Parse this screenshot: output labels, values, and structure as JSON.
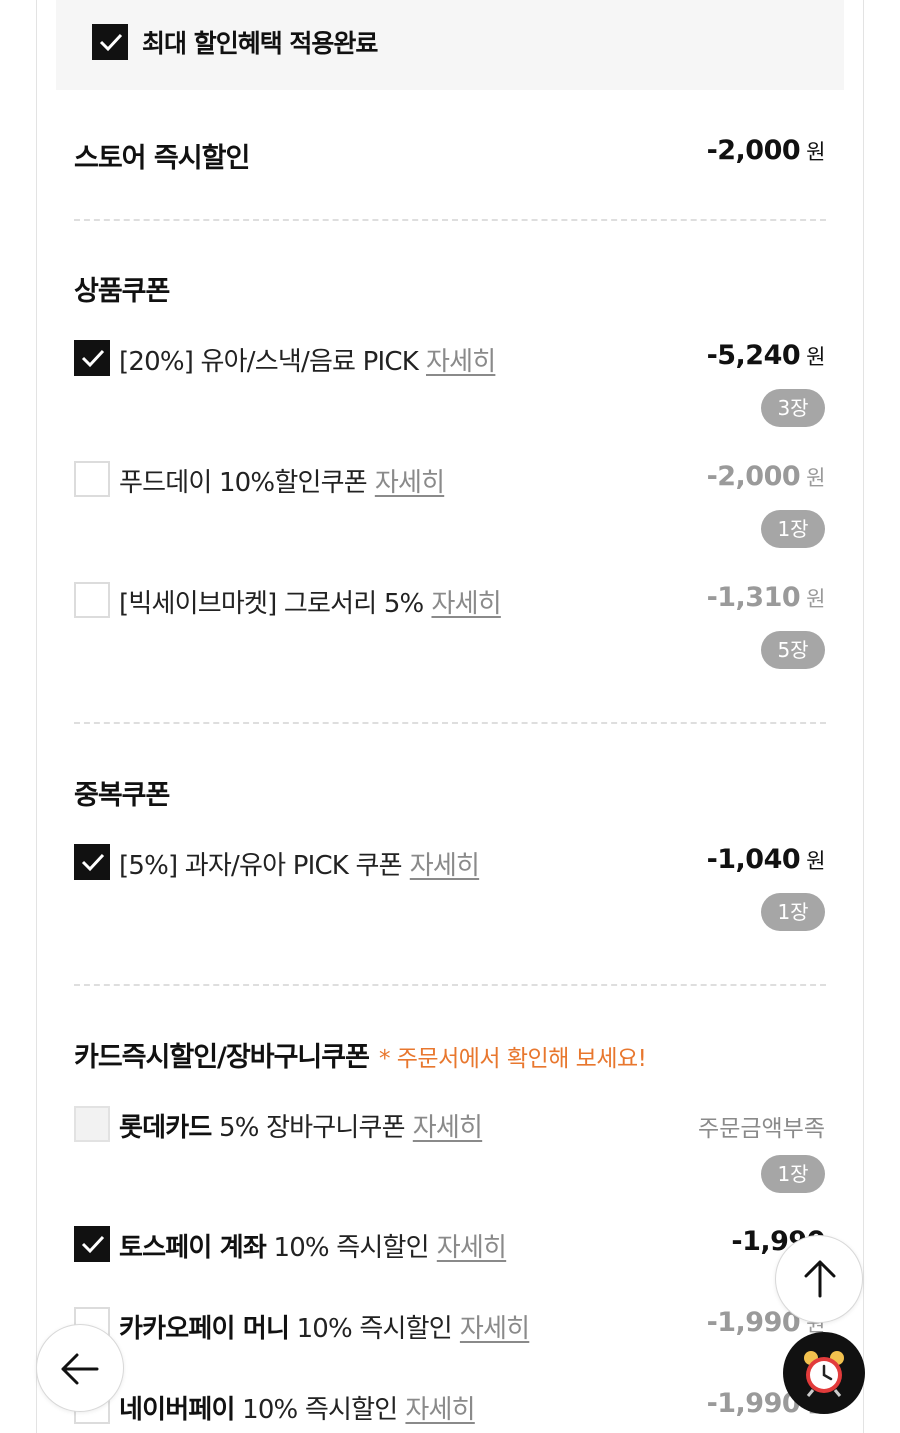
{
  "header": {
    "title": "최대 할인혜택 적용완료"
  },
  "store": {
    "title": "스토어 즉시할인",
    "amount": "-2,000",
    "unit": "원"
  },
  "product_coupons": {
    "title": "상품쿠폰",
    "items": [
      {
        "label": "[20%] 유아/스낵/음료 PICK",
        "detail": "자세히",
        "amount": "-5,240",
        "unit": "원",
        "count": "3장"
      },
      {
        "label": "푸드데이 10%할인쿠폰",
        "detail": "자세히",
        "amount": "-2,000",
        "unit": "원",
        "count": "1장"
      },
      {
        "label": "[빅세이브마켓] 그로서리 5%",
        "detail": "자세히",
        "amount": "-1,310",
        "unit": "원",
        "count": "5장"
      }
    ]
  },
  "dup_coupons": {
    "title": "중복쿠폰",
    "items": [
      {
        "label": "[5%] 과자/유아 PICK 쿠폰",
        "detail": "자세히",
        "amount": "-1,040",
        "unit": "원",
        "count": "1장"
      }
    ]
  },
  "card": {
    "title": "카드즉시할인/장바구니쿠폰",
    "note": "* 주문서에서 확인해 보세요!",
    "items": [
      {
        "brand": "롯데카드",
        "label": "5% 장바구니쿠폰",
        "detail": "자세히",
        "status": "주문금액부족",
        "count": "1장"
      },
      {
        "brand": "토스페이 계좌",
        "label": "10% 즉시할인",
        "detail": "자세히",
        "amount": "-1,990"
      },
      {
        "brand": "카카오페이 머니",
        "label": "10% 즉시할인",
        "detail": "자세히",
        "amount": "-1,990",
        "unit": "원"
      },
      {
        "brand": "네이버페이",
        "label": "10% 즉시할인",
        "detail": "자세히",
        "amount": "-1,990",
        "unit": "원"
      }
    ]
  },
  "icons": {
    "scroll_top": "arrow-up-icon",
    "back": "arrow-left-icon",
    "alarm": "alarm-clock-icon"
  },
  "colors": {
    "checked": "#111111",
    "note": "#e8772e",
    "badge": "#a6a6a6"
  }
}
